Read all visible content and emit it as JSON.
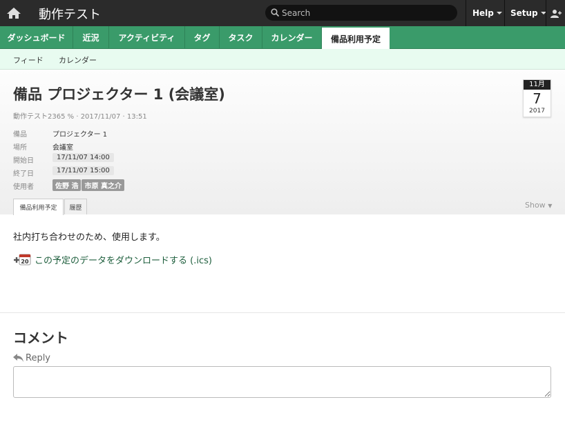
{
  "app": {
    "title": "動作テスト"
  },
  "search": {
    "placeholder": "Search"
  },
  "topmenu": {
    "help": "Help",
    "setup": "Setup"
  },
  "nav": {
    "tabs": [
      {
        "label": "ダッシュボード"
      },
      {
        "label": "近況"
      },
      {
        "label": "アクティビティ"
      },
      {
        "label": "タグ"
      },
      {
        "label": "タスク"
      },
      {
        "label": "カレンダー"
      },
      {
        "label": "備品利用予定"
      }
    ],
    "active": "備品利用予定"
  },
  "subnav": {
    "items": [
      {
        "label": "フィード"
      },
      {
        "label": "カレンダー"
      }
    ]
  },
  "event": {
    "title": "備品 プロジェクター 1 (会議室)",
    "author": "動作テスト2365",
    "timestamp": "2017/11/07 · 13:51",
    "calendar": {
      "month": "11月",
      "day": "7",
      "year": "2017"
    },
    "fields": {
      "equipment_label": "備品",
      "equipment": "プロジェクター 1",
      "location_label": "場所",
      "location": "会議室",
      "start_label": "開始日",
      "start": "17/11/07 14:00",
      "end_label": "終了日",
      "end": "17/11/07 15:00",
      "users_label": "使用者",
      "users": [
        "佐野 浩",
        "市原 真之介"
      ]
    },
    "tabs": [
      {
        "label": "備品利用予定"
      },
      {
        "label": "履歴"
      }
    ],
    "show_label": "Show",
    "description": "社内打ち合わせのため、使用します。",
    "ics_link": "この予定のデータをダウンロードする (.ics)",
    "ics_badge": "20"
  },
  "comments": {
    "title": "コメント",
    "reply_label": "Reply"
  },
  "colors": {
    "topbar": "#2b2b2b",
    "nav_green": "#3a9b6a",
    "subnav": "#e8fbf0",
    "link": "#1d5e3c"
  }
}
